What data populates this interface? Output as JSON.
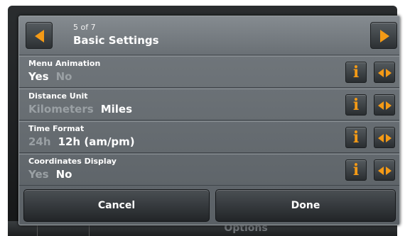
{
  "background": {
    "bottom_label": "Options"
  },
  "header": {
    "page_counter": "5 of 7",
    "title": "Basic Settings"
  },
  "settings": [
    {
      "label": "Menu Animation",
      "options": [
        "Yes",
        "No"
      ],
      "selected": "Yes"
    },
    {
      "label": "Distance Unit",
      "options": [
        "Kilometers",
        "Miles"
      ],
      "selected": "Miles"
    },
    {
      "label": "Time Format",
      "options": [
        "24h",
        "12h (am/pm)"
      ],
      "selected": "12h (am/pm)"
    },
    {
      "label": "Coordinates Display",
      "options": [
        "Yes",
        "No"
      ],
      "selected": "No"
    }
  ],
  "footer": {
    "cancel_label": "Cancel",
    "done_label": "Done"
  },
  "icons": {
    "prev": "chevron-left-icon",
    "next": "chevron-right-icon",
    "info": "info-icon",
    "toggle": "toggle-arrows-icon"
  },
  "colors": {
    "accent": "#f49a16",
    "selected_text": "#ffffff",
    "unselected_text": "#9aa0a4"
  }
}
